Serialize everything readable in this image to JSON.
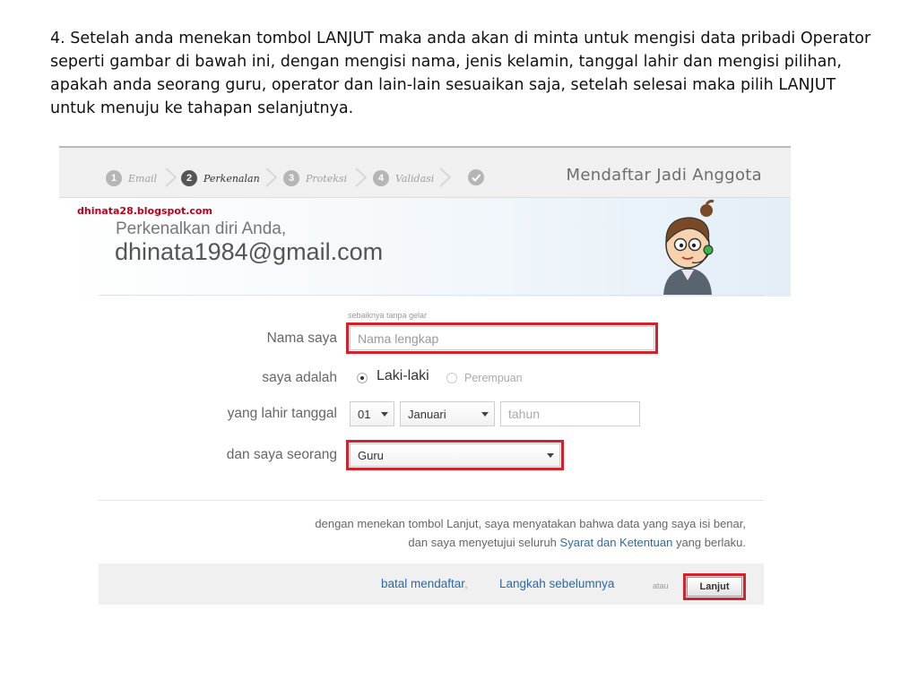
{
  "instruction": {
    "text": "4. Setelah anda menekan tombol LANJUT maka anda akan di minta untuk mengisi data pribadi Operator seperti gambar di bawah ini, dengan mengisi nama, jenis kelamin, tanggal lahir dan mengisi pilihan, apakah anda seorang guru, operator dan lain-lain sesuaikan saja, setelah selesai maka pilih LANJUT untuk menuju ke tahapan selanjutnya."
  },
  "wizard": {
    "steps": [
      {
        "num": "1",
        "label": "Email"
      },
      {
        "num": "2",
        "label": "Perkenalan"
      },
      {
        "num": "3",
        "label": "Proteksi"
      },
      {
        "num": "4",
        "label": "Validasi"
      }
    ],
    "title": "Mendaftar Jadi Anggota"
  },
  "hero": {
    "watermark": "dhinata28.blogspot.com",
    "greeting": "Perkenalkan diri Anda,",
    "email": "dhinata1984@gmail.com"
  },
  "form": {
    "hint": "sebaiknya tanpa gelar",
    "name_label": "Nama saya",
    "name_placeholder": "Nama lengkap",
    "gender_label": "saya adalah",
    "gender_male": "Laki-laki",
    "gender_female": "Perempuan",
    "birth_label": "yang lahir tanggal",
    "birth_day": "01",
    "birth_month": "Januari",
    "birth_year_placeholder": "tahun",
    "role_label": "dan saya seorang",
    "role_value": "Guru"
  },
  "terms": {
    "line1": "dengan menekan tombol Lanjut, saya menyatakan bahwa data yang saya isi benar,",
    "line2_pre": "dan saya menyetujui seluruh",
    "line2_link": "Syarat dan Ketentuan",
    "line2_post": "yang berlaku."
  },
  "footer": {
    "cancel": "batal mendaftar",
    "comma": ",",
    "previous": "Langkah sebelumnya",
    "or": "atau",
    "next": "Lanjut"
  },
  "colors": {
    "highlight_red": "#d6202a",
    "link_blue": "#2a6aa8"
  }
}
